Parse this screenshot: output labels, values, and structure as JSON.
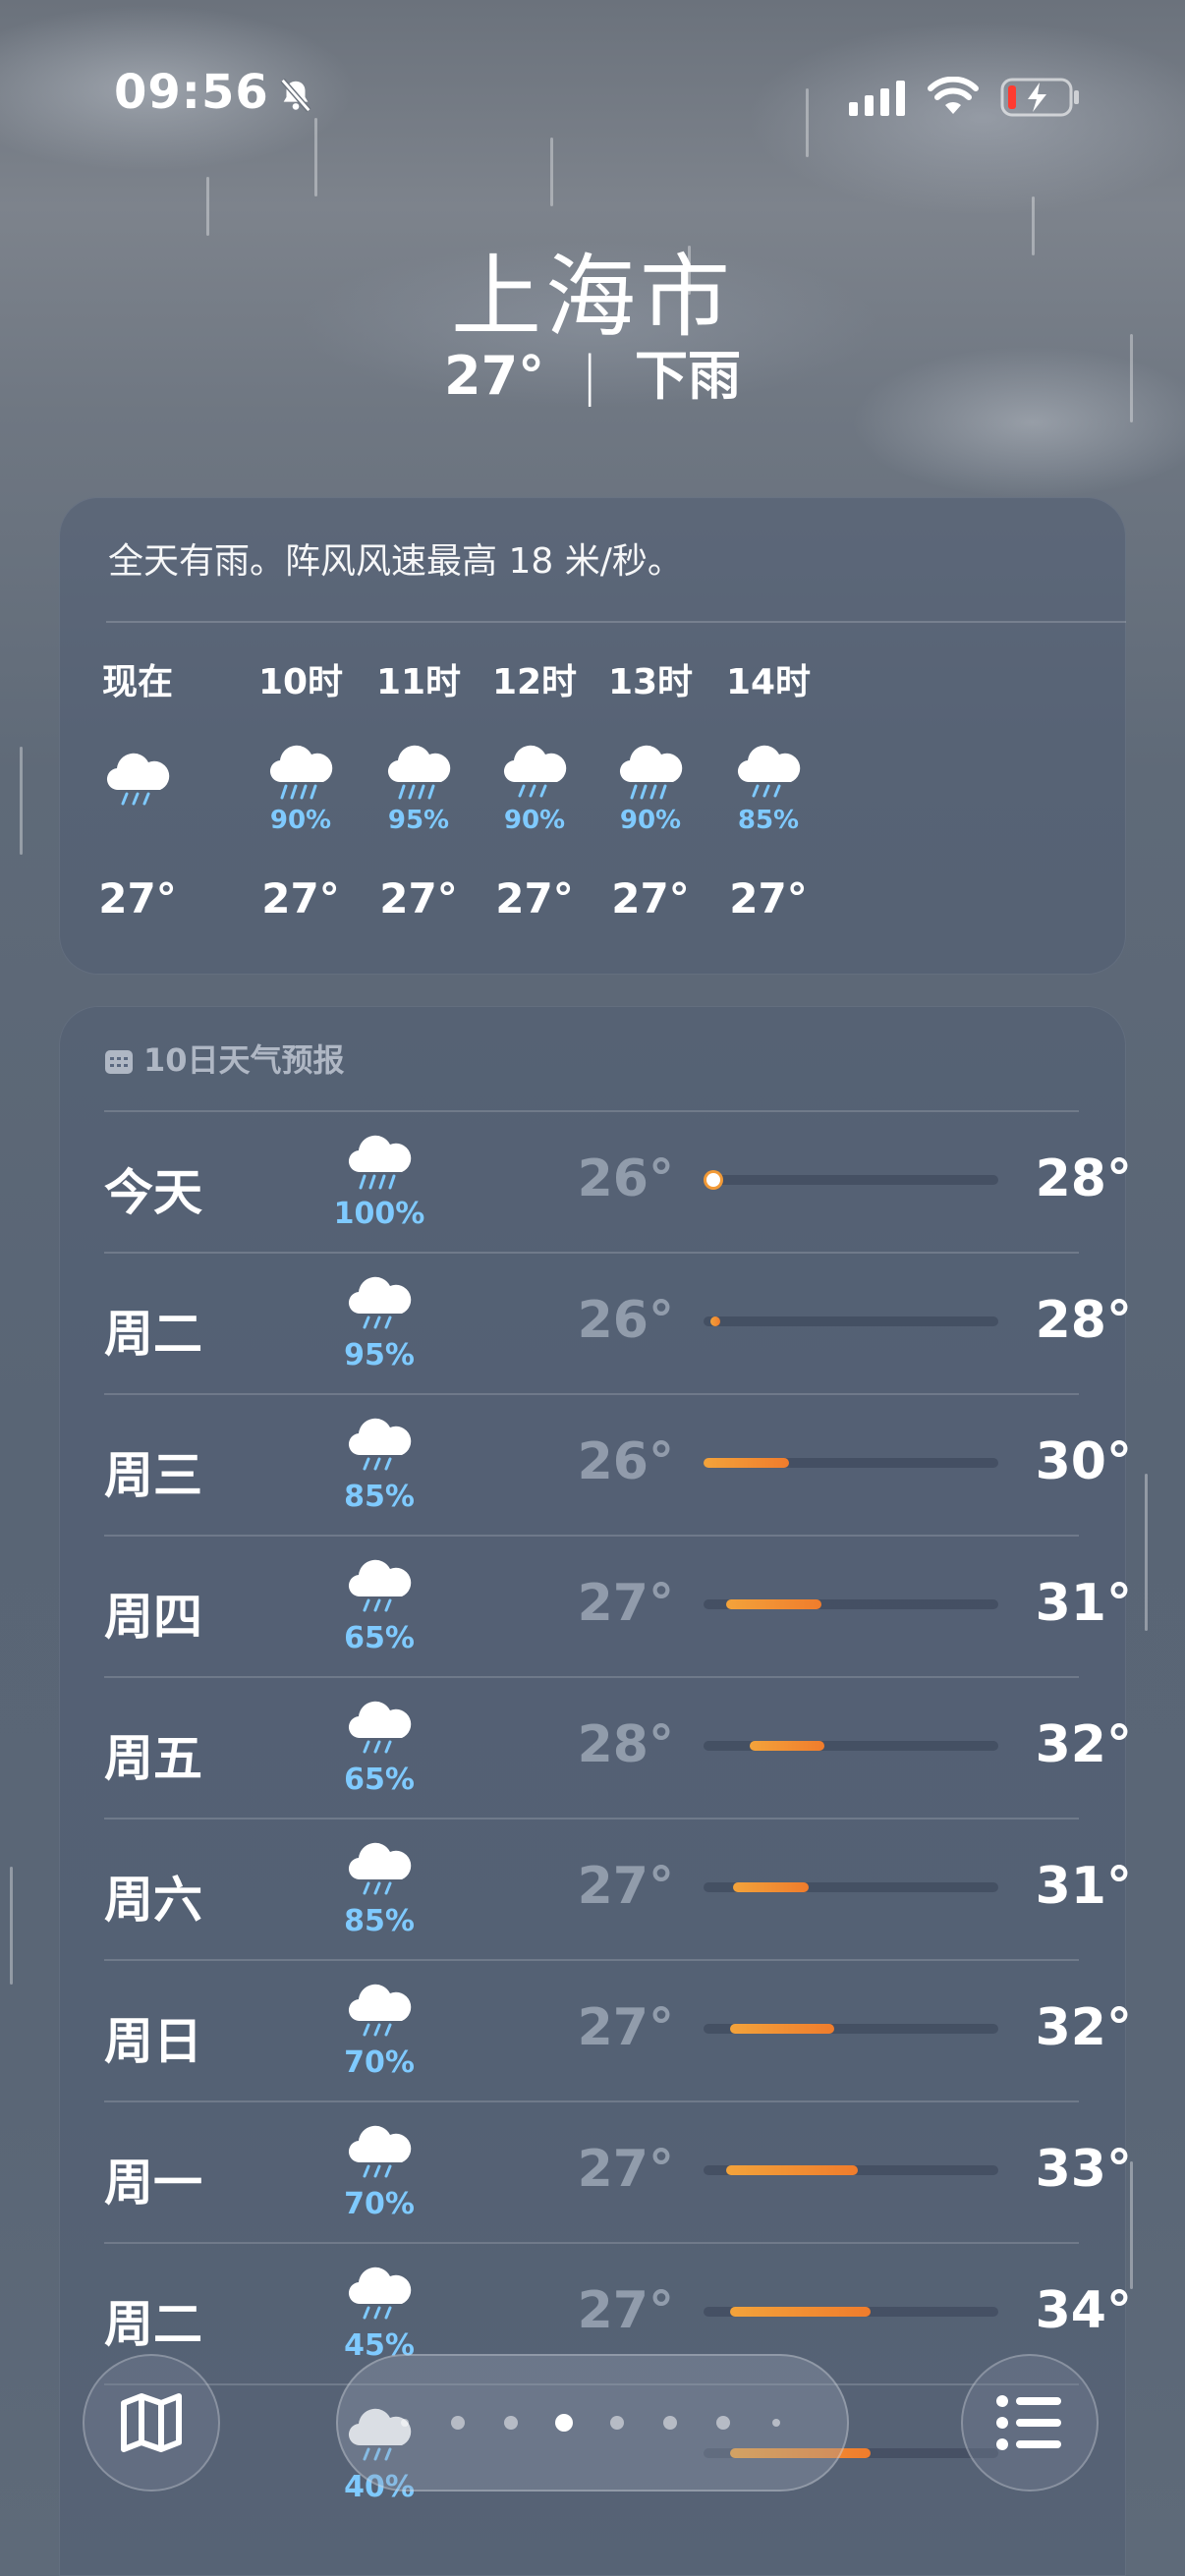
{
  "status_bar": {
    "time": "09:56"
  },
  "header": {
    "city": "上海市",
    "temp": "27°",
    "separator": "|",
    "condition": "下雨"
  },
  "hourly": {
    "summary": "全天有雨。阵风风速最高 18 米/秒。",
    "items": [
      {
        "label": "现在",
        "pct": "",
        "temp": "27°"
      },
      {
        "label": "10时",
        "pct": "90%",
        "temp": "27°"
      },
      {
        "label": "11时",
        "pct": "95%",
        "temp": "27°"
      },
      {
        "label": "12时",
        "pct": "90%",
        "temp": "27°"
      },
      {
        "label": "13时",
        "pct": "90%",
        "temp": "27°"
      },
      {
        "label": "14时",
        "pct": "85%",
        "temp": "27°"
      }
    ]
  },
  "forecast": {
    "title": "10日天气预报",
    "scale": {
      "min": 26,
      "max": 35
    },
    "days": [
      {
        "day": "今天",
        "pct": "100%",
        "low": "26°",
        "high": "28°",
        "lo_v": 26.1,
        "hi_v": 26.5,
        "now": 26.3
      },
      {
        "day": "周二",
        "pct": "95%",
        "low": "26°",
        "high": "28°",
        "lo_v": 26.2,
        "hi_v": 26.5
      },
      {
        "day": "周三",
        "pct": "85%",
        "low": "26°",
        "high": "30°",
        "lo_v": 26.0,
        "hi_v": 28.6
      },
      {
        "day": "周四",
        "pct": "65%",
        "low": "27°",
        "high": "31°",
        "lo_v": 26.7,
        "hi_v": 29.6
      },
      {
        "day": "周五",
        "pct": "65%",
        "low": "28°",
        "high": "32°",
        "lo_v": 27.4,
        "hi_v": 29.7
      },
      {
        "day": "周六",
        "pct": "85%",
        "low": "27°",
        "high": "31°",
        "lo_v": 26.9,
        "hi_v": 29.2
      },
      {
        "day": "周日",
        "pct": "70%",
        "low": "27°",
        "high": "32°",
        "lo_v": 26.8,
        "hi_v": 30.0
      },
      {
        "day": "周一",
        "pct": "70%",
        "low": "27°",
        "high": "33°",
        "lo_v": 26.7,
        "hi_v": 30.7
      },
      {
        "day": "周二",
        "pct": "45%",
        "low": "27°",
        "high": "34°",
        "lo_v": 26.8,
        "hi_v": 31.1
      },
      {
        "day": "",
        "pct": "40%",
        "low": "",
        "high": "",
        "lo_v": 26.8,
        "hi_v": 31.1
      }
    ]
  },
  "pager": {
    "count": 8,
    "active": 3
  },
  "icons": {
    "map": "map-icon",
    "list": "list-icon",
    "rain": "cloud-rain-icon"
  }
}
